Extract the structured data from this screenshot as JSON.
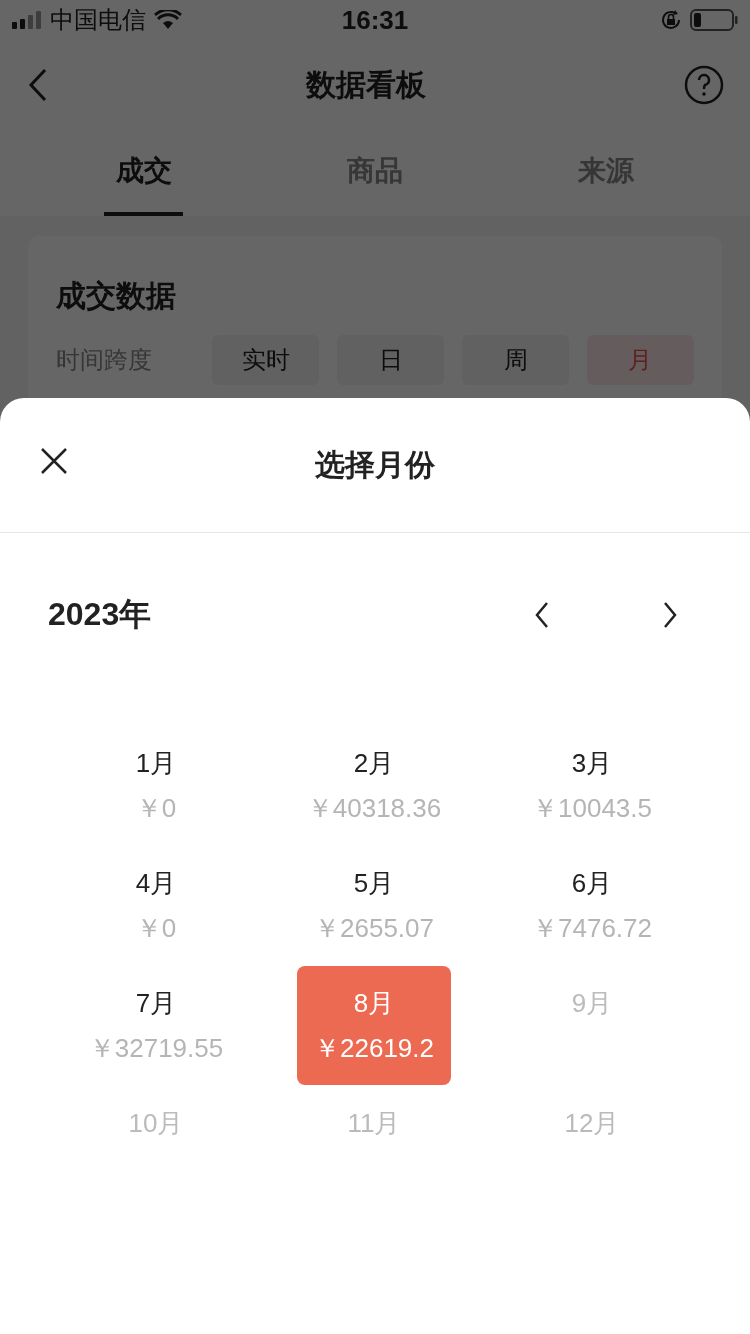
{
  "status_bar": {
    "carrier": "中国电信",
    "time": "16:31"
  },
  "nav": {
    "title": "数据看板"
  },
  "tabs": [
    {
      "label": "成交",
      "selected": true
    },
    {
      "label": "商品",
      "selected": false
    },
    {
      "label": "来源",
      "selected": false
    }
  ],
  "card": {
    "title": "成交数据",
    "time_span": {
      "label": "时间跨度",
      "options": [
        {
          "label": "实时",
          "selected": false
        },
        {
          "label": "日",
          "selected": false
        },
        {
          "label": "周",
          "selected": false
        },
        {
          "label": "月",
          "selected": true
        }
      ]
    }
  },
  "month_picker": {
    "title": "选择月份",
    "year": "2023年",
    "months": [
      {
        "label": "1月",
        "amount": "￥0",
        "selected": false,
        "disabled": false
      },
      {
        "label": "2月",
        "amount": "￥40318.36",
        "selected": false,
        "disabled": false
      },
      {
        "label": "3月",
        "amount": "￥10043.5",
        "selected": false,
        "disabled": false
      },
      {
        "label": "4月",
        "amount": "￥0",
        "selected": false,
        "disabled": false
      },
      {
        "label": "5月",
        "amount": "￥2655.07",
        "selected": false,
        "disabled": false
      },
      {
        "label": "6月",
        "amount": "￥7476.72",
        "selected": false,
        "disabled": false
      },
      {
        "label": "7月",
        "amount": "￥32719.55",
        "selected": false,
        "disabled": false
      },
      {
        "label": "8月",
        "amount": "￥22619.2",
        "selected": true,
        "disabled": false
      },
      {
        "label": "9月",
        "selected": false,
        "disabled": true
      },
      {
        "label": "10月",
        "selected": false,
        "disabled": true
      },
      {
        "label": "11月",
        "selected": false,
        "disabled": true
      },
      {
        "label": "12月",
        "selected": false,
        "disabled": true
      }
    ]
  }
}
